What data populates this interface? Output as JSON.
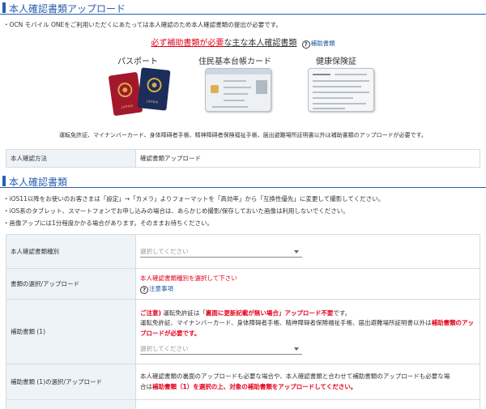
{
  "upload_section": {
    "title": "本人確認書類アップロード",
    "intro": "・OCN モバイル ONEをご利用いただくにあたっては本人確認のため本人確認書類の提出が必要です。",
    "heading_red": "必ず補助書類が必要",
    "heading_rest": "な主な本人確認書類",
    "help_link": "補助書類",
    "documents": [
      {
        "caption": "パスポート",
        "cover_text": "JAPAN"
      },
      {
        "caption": "住民基本台帳カード"
      },
      {
        "caption": "健康保険証"
      }
    ],
    "note": "運転免許証、マイナンバーカード、身体障碍者手帳、精神障碍者保険福祉手帳、届出避難場所証明書以外は補助書類のアップロードが必要です。"
  },
  "method_row": {
    "label": "本人確認方法",
    "value": "確認書類アップロード"
  },
  "docs_section": {
    "title": "本人確認書類",
    "bullets": [
      "・iOS11以降をお使いのお客さまは「設定」→「カメラ」よりフォーマットを「高効率」から「互換性優先」に変更して撮影してください。",
      "・iOS系のタブレット、スマートフォンでお申し込みの場合は、あらかじめ撮影/保存しておいた画像は利用しないでください。",
      "・画像アップには1分程度かかる場合があります。そのままお待ちください。"
    ]
  },
  "form": {
    "type_label": "本人確認書類種別",
    "type_placeholder": "選択してください",
    "upload_label": "書類の選択/アップロード",
    "upload_prompt": "本人確認書類種別を選択して下さい",
    "upload_help": "注意事項",
    "aux_label": "補助書類 (1)",
    "aux_note_caution": "ご注意)",
    "aux_note_text1": " 運転免許証は「",
    "aux_note_highlight": "裏面に更新記載が無い場合」アップロード不要",
    "aux_note_text2": "です。",
    "aux_note_line2": "運転免許証、マイナンバーカード、身体障碍者手帳、精神障碍者保険福祉手帳、届出避難場所証明書以外は",
    "aux_note_red_end": "補助書類のアップロードが必要です。",
    "aux_placeholder": "選択してください",
    "aux_upload_label": "補助書類 (1)の選択/アップロード",
    "aux_upload_text1": "本人確認書類の裏面のアップロードも必要な場合や、本人確認書類と合わせて補助書類のアップロードも必要な場",
    "aux_upload_text2": "合は",
    "aux_upload_red": "補助書類（1）を選択の上、対象の補助書類をアップロードしてください。"
  },
  "colors": {
    "accent": "#2a5fae",
    "alert": "#e4001a",
    "label_bg": "#eef3f8",
    "passport_red": "#a3172a",
    "passport_navy": "#1b2d5a"
  }
}
